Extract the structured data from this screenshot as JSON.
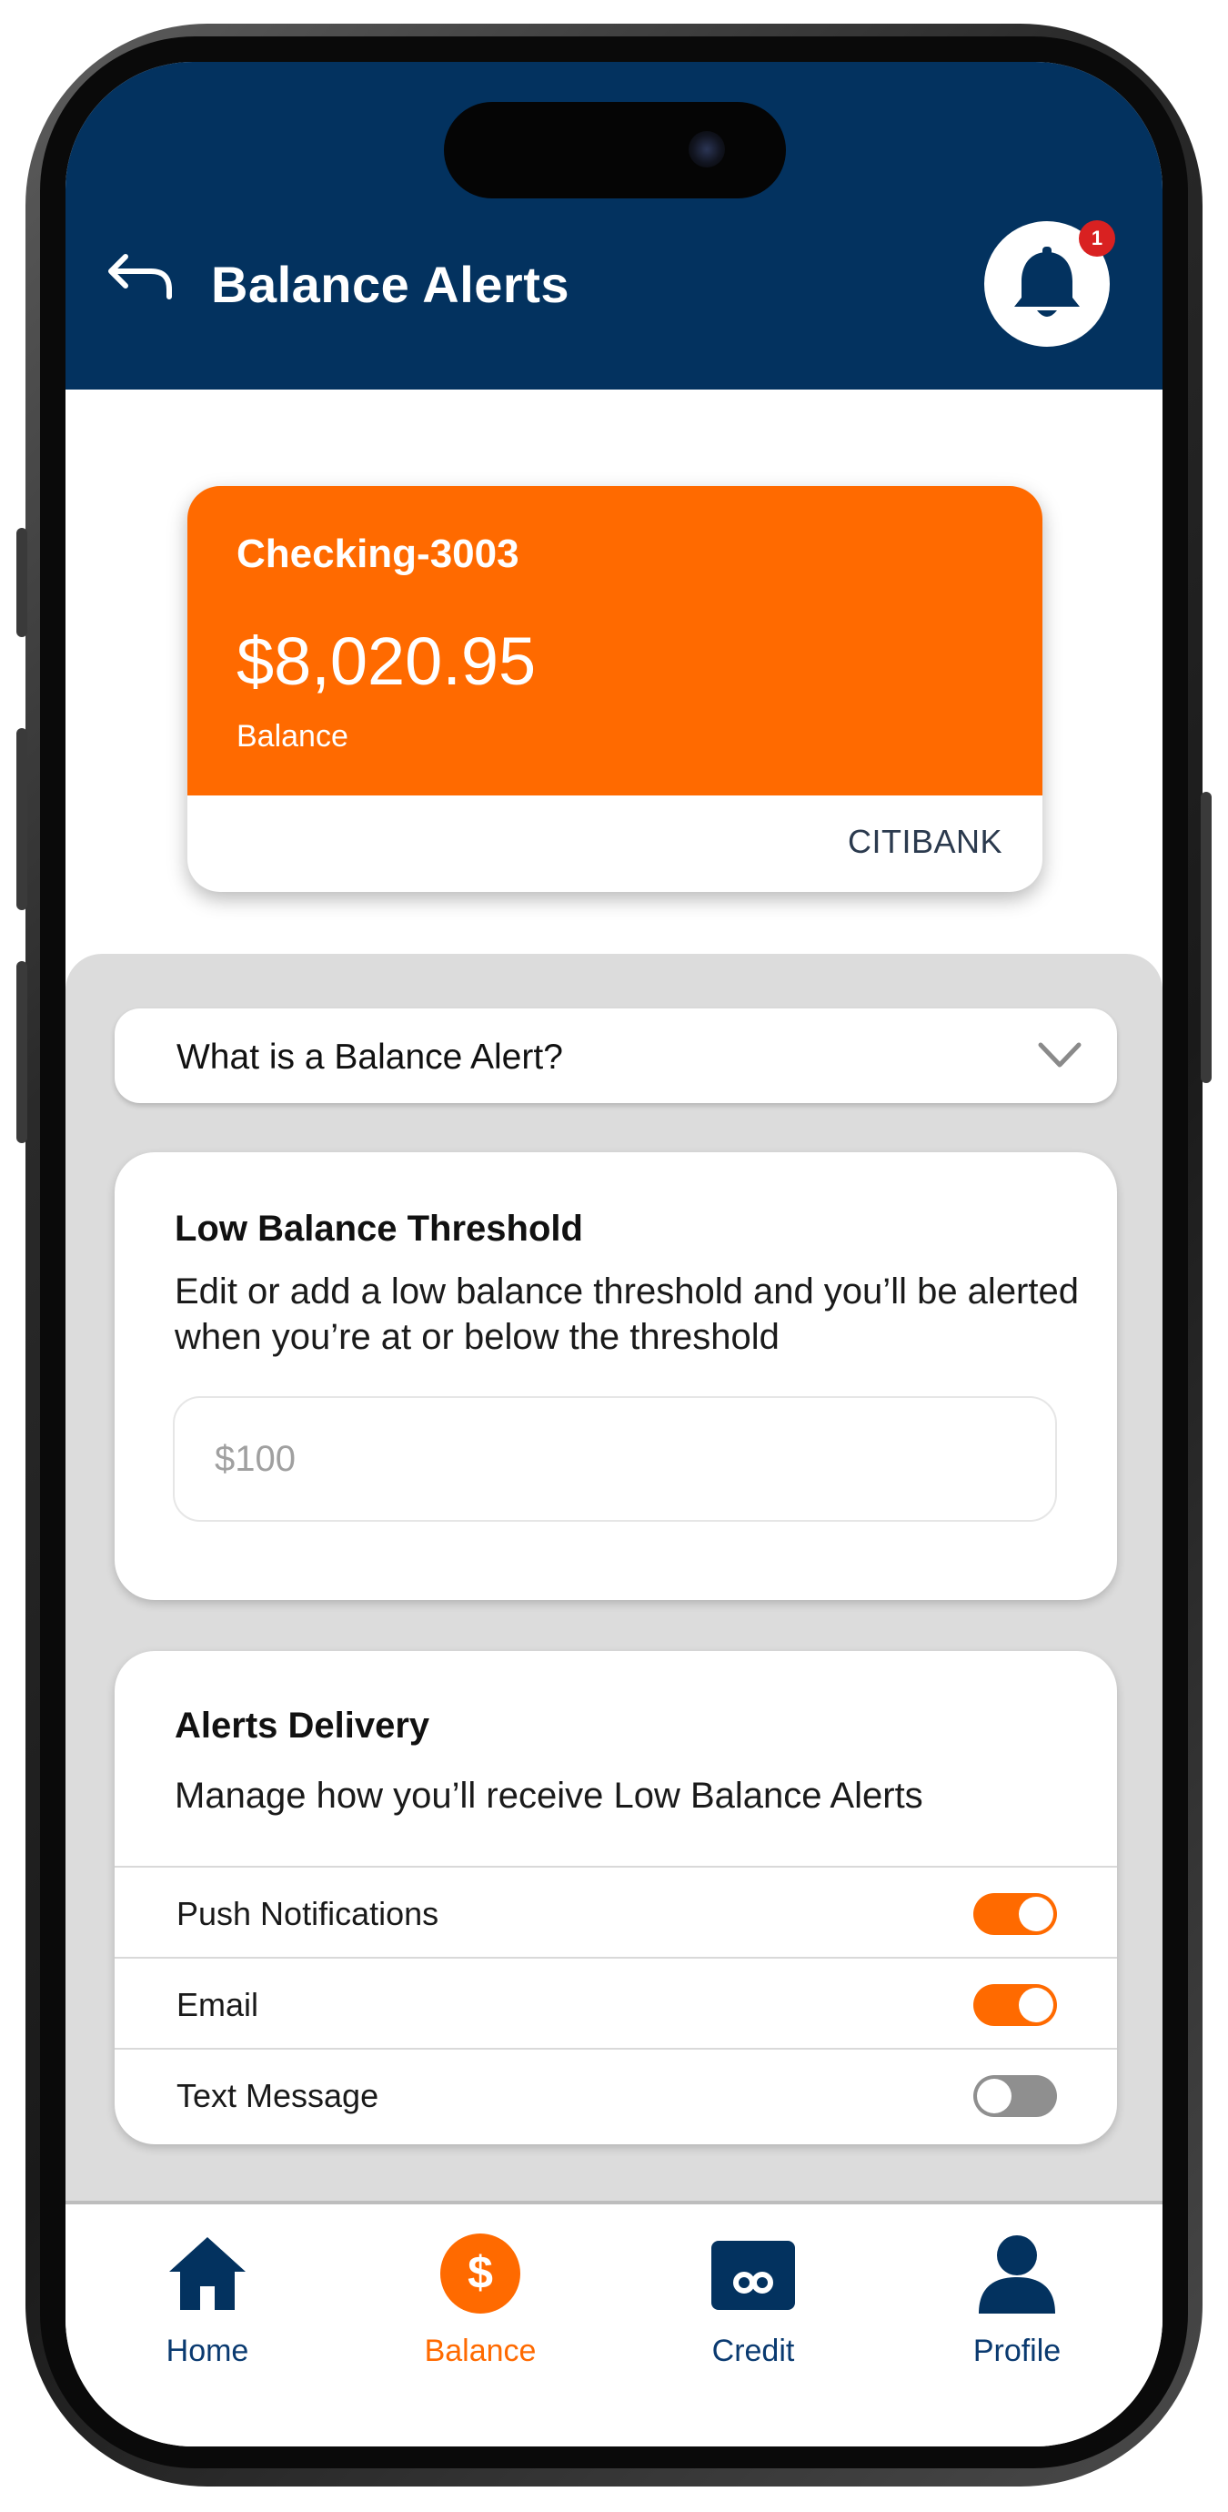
{
  "header": {
    "title": "Balance Alerts",
    "back_icon": "back-arrow-icon",
    "notification_icon": "bell-icon",
    "notification_count": "1"
  },
  "account": {
    "name": "Checking-3003",
    "balance": "$8,020.95",
    "balance_label": "Balance",
    "bank": "CITIBANK"
  },
  "faq": {
    "title": "What is a Balance Alert?"
  },
  "threshold": {
    "heading": "Low Balance Threshold",
    "description": "Edit or add a low balance threshold and you’ll be alerted when you’re at or below the threshold",
    "placeholder": "$100"
  },
  "delivery": {
    "heading": "Alerts Delivery",
    "description": "Manage how you’ll receive Low Balance Alerts",
    "options": [
      {
        "label": "Push Notifications",
        "enabled": true
      },
      {
        "label": "Email",
        "enabled": true
      },
      {
        "label": "Text Message",
        "enabled": false
      }
    ]
  },
  "nav": {
    "items": [
      {
        "label": "Home",
        "icon": "home-icon",
        "active": false
      },
      {
        "label": "Balance",
        "icon": "dollar-icon",
        "active": true
      },
      {
        "label": "Credit",
        "icon": "credit-card-icon",
        "active": false
      },
      {
        "label": "Profile",
        "icon": "profile-icon",
        "active": false
      }
    ]
  },
  "colors": {
    "primary": "#03325f",
    "accent": "#ff6a00",
    "badge": "#d92121",
    "panel": "#dcdcdc"
  }
}
